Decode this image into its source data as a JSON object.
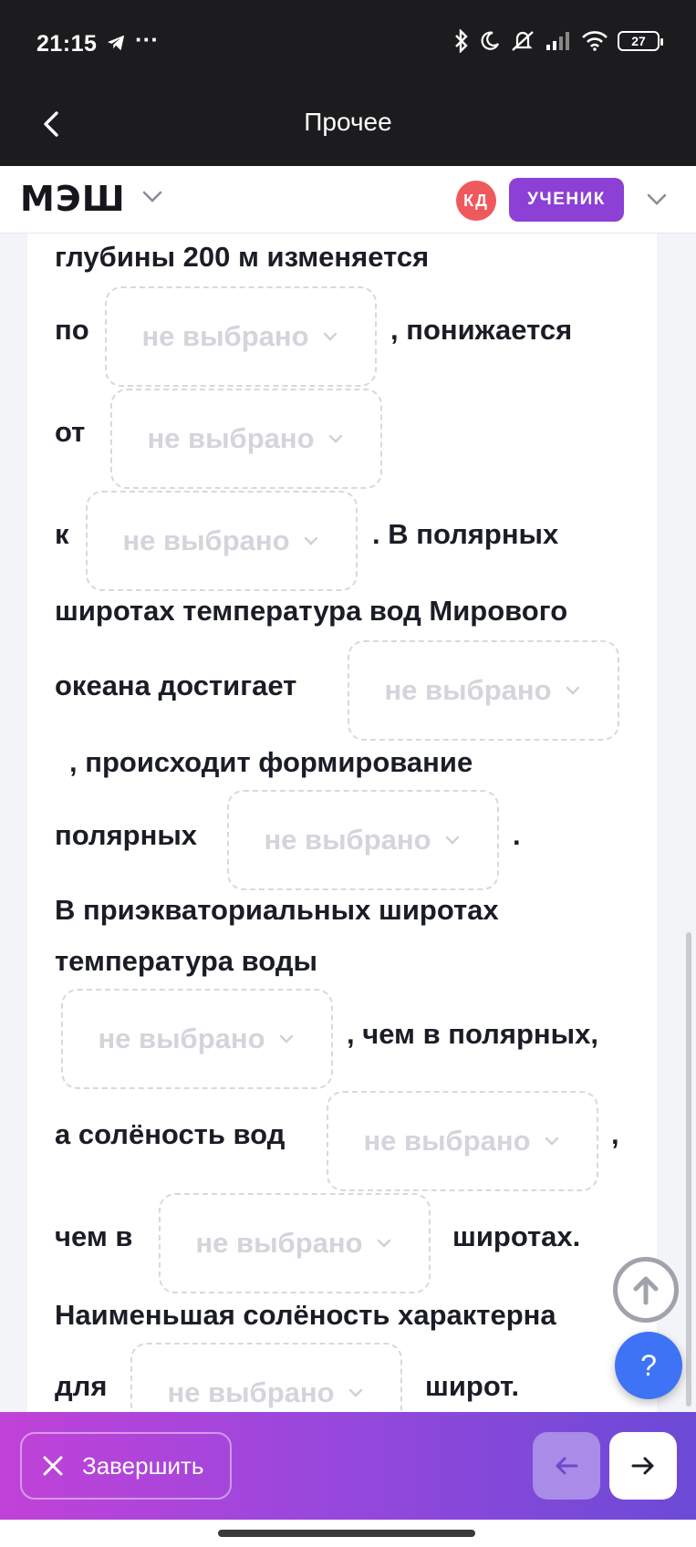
{
  "status_bar": {
    "time": "21:15",
    "more": "···",
    "battery": "27"
  },
  "app_bar": {
    "title": "Прочее"
  },
  "header": {
    "logo": "МЭШ",
    "avatar_initials": "КД",
    "role": "УЧЕНИК"
  },
  "exercise": {
    "text": {
      "t1": "глубины 200 м изменяется",
      "t2": "по",
      "t3": ", понижается",
      "t4": "от",
      "t5": "к",
      "t6": ". В полярных",
      "t7": "широтах температура вод Мирового",
      "t8": "океана достигает",
      "t9": ", происходит формирование",
      "t10": "полярных",
      "t11": ".",
      "t12": "В приэкваториальных широтах",
      "t13": "температура воды",
      "t14": ", чем в полярных,",
      "t15": "а солёность вод",
      "t16": ",",
      "t17": "чем в",
      "t18": "широтах.",
      "t19": "Наименьшая солёность характерна",
      "t20": "для",
      "t21": "широт."
    },
    "dropdown_placeholder": "не выбрано",
    "dropdowns": [
      {
        "value": "не выбрано"
      },
      {
        "value": "не выбрано"
      },
      {
        "value": "не выбрано"
      },
      {
        "value": "не выбрано"
      },
      {
        "value": "не выбрано"
      },
      {
        "value": "не выбрано"
      },
      {
        "value": "не выбрано"
      },
      {
        "value": "не выбрано"
      },
      {
        "value": "не выбрано"
      }
    ]
  },
  "fab": {
    "help": "?"
  },
  "bottom_bar": {
    "finish_label": "Завершить"
  },
  "colors": {
    "accent": "#8c40d6",
    "avatar": "#f0595c",
    "help": "#3f73f5",
    "placeholder": "#d3d5db"
  },
  "icons": [
    "telegram-icon",
    "bluetooth-icon",
    "moon-icon",
    "mute-icon",
    "signal-icon",
    "wifi-icon",
    "battery-icon",
    "back-icon",
    "chevron-down-icon",
    "arrow-up-icon",
    "close-icon",
    "arrow-left-icon",
    "arrow-right-icon"
  ]
}
